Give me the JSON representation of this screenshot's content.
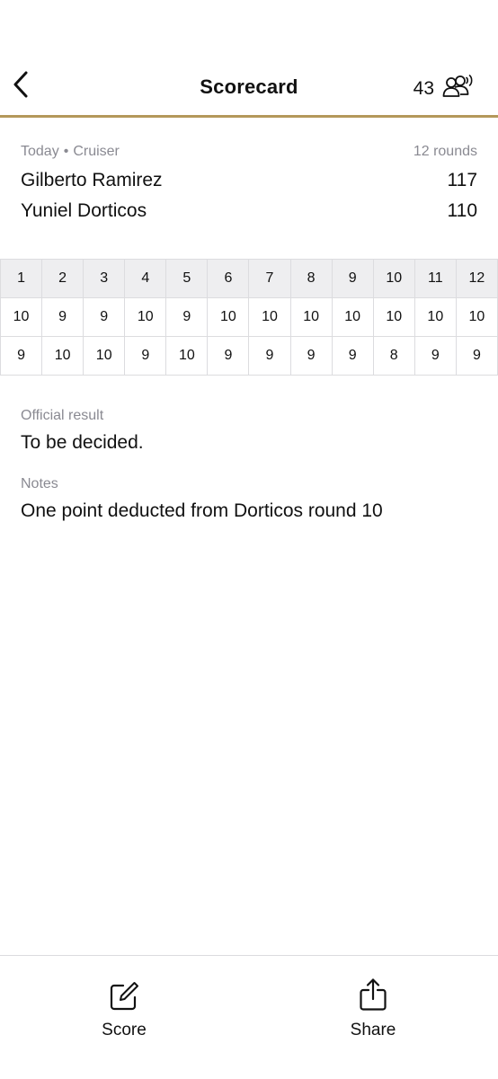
{
  "header": {
    "title": "Scorecard",
    "viewer_count": "43",
    "rule_color": "#b4985a"
  },
  "bout": {
    "date": "Today",
    "separator": "•",
    "division": "Cruiser",
    "rounds_label": "12 rounds",
    "fighters": [
      {
        "name": "Gilberto Ramirez",
        "total": "117"
      },
      {
        "name": "Yuniel Dorticos",
        "total": "110"
      }
    ]
  },
  "scorecard": {
    "rounds": [
      "1",
      "2",
      "3",
      "4",
      "5",
      "6",
      "7",
      "8",
      "9",
      "10",
      "11",
      "12"
    ],
    "rows": [
      [
        "10",
        "9",
        "9",
        "10",
        "9",
        "10",
        "10",
        "10",
        "10",
        "10",
        "10",
        "10"
      ],
      [
        "9",
        "10",
        "10",
        "9",
        "10",
        "9",
        "9",
        "9",
        "9",
        "8",
        "9",
        "9"
      ]
    ]
  },
  "result": {
    "label": "Official result",
    "value": "To be decided."
  },
  "notes": {
    "label": "Notes",
    "value": "One point deducted from Dorticos round 10"
  },
  "tabbar": {
    "score_label": "Score",
    "share_label": "Share"
  },
  "icons": {
    "back": "chevron-left-icon",
    "viewers": "people-broadcast-icon",
    "score": "edit-square-icon",
    "share": "share-upload-icon"
  }
}
